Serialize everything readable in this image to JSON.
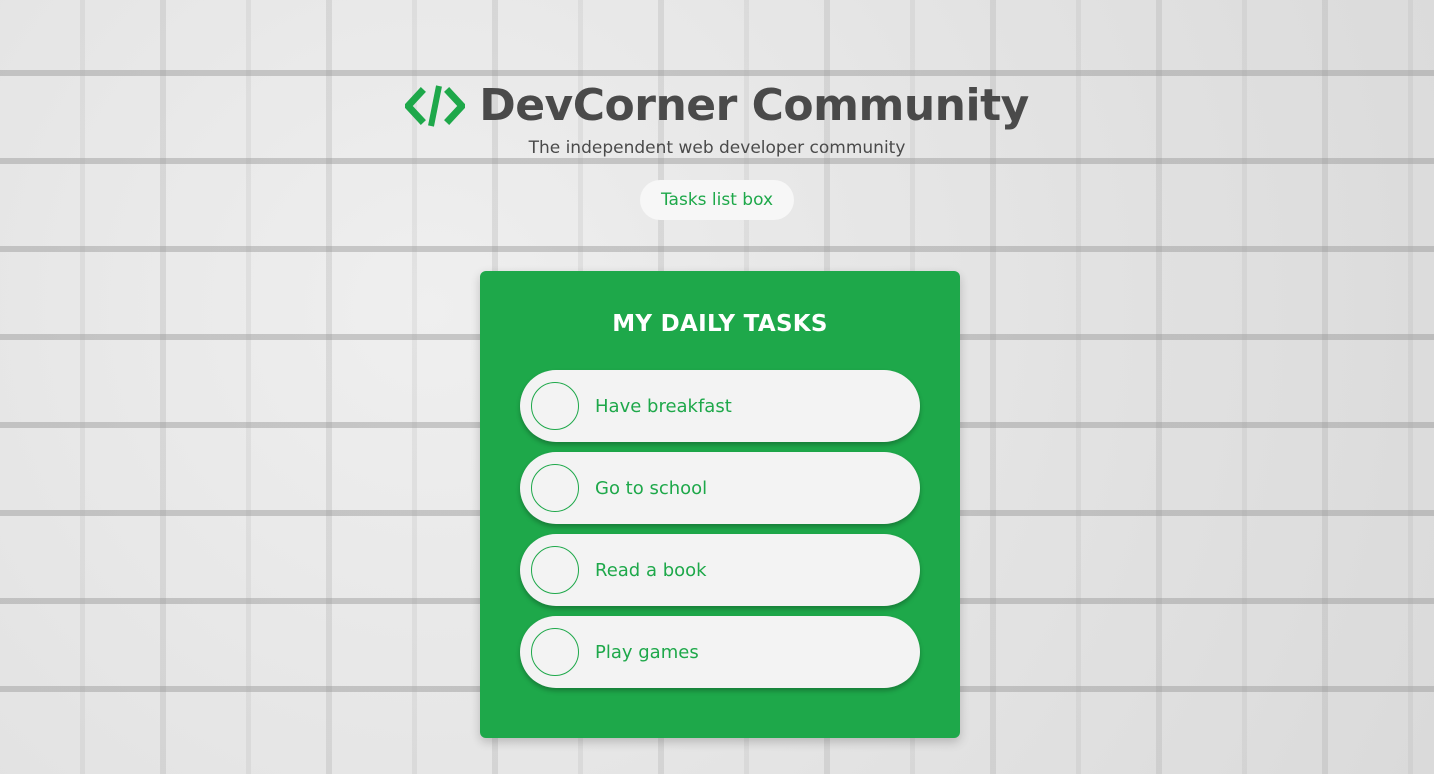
{
  "colors": {
    "accent": "#1ea84a",
    "title_text": "#4a4a4a",
    "card_bg": "#1ea84a",
    "item_bg": "#f3f3f3"
  },
  "header": {
    "logo_icon": "code-brackets-icon",
    "title": "DevCorner Community",
    "subtitle": "The independent web developer community",
    "pill_label": "Tasks list box"
  },
  "card": {
    "title": "MY DAILY TASKS",
    "tasks": [
      {
        "label": "Have breakfast",
        "done": false
      },
      {
        "label": "Go to school",
        "done": false
      },
      {
        "label": "Read a book",
        "done": false
      },
      {
        "label": "Play games",
        "done": false
      }
    ]
  }
}
